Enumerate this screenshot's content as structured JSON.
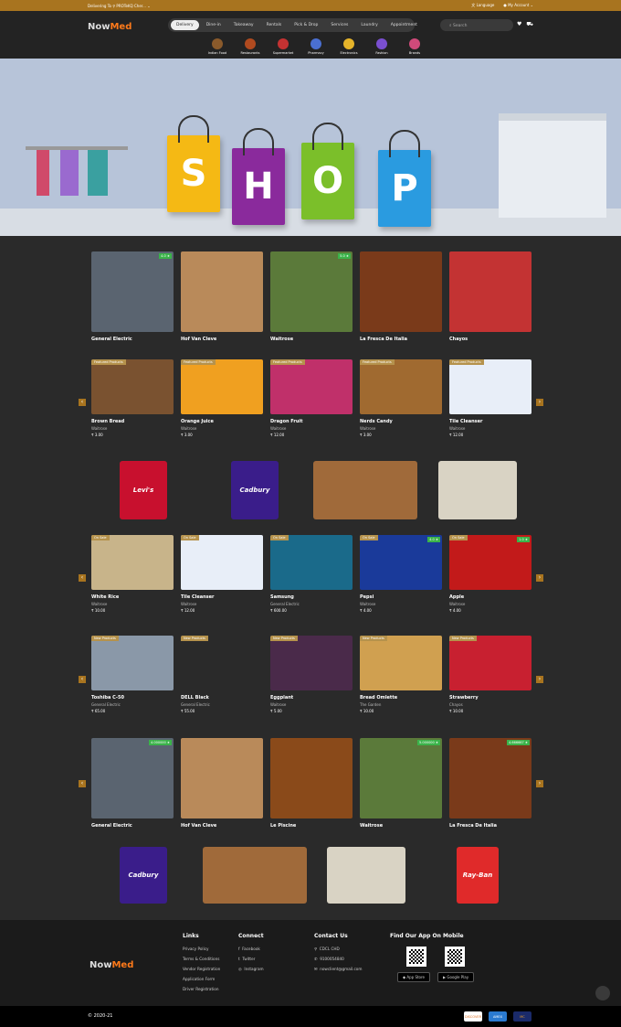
{
  "topbar": {
    "delivering": "Delivering To",
    "location": "PROTeKQ Cher...",
    "language": "Language",
    "account": "My Account"
  },
  "header": {
    "logo_a": "Now",
    "logo_b": "Med",
    "search_placeholder": "Search"
  },
  "nav": [
    "Delivery",
    "Dine-in",
    "Takeaway",
    "Rentals",
    "Pick & Drop",
    "Services",
    "Laundry",
    "Appointment"
  ],
  "categories": [
    {
      "label": "Indian Food",
      "color": "#8a5a2b"
    },
    {
      "label": "Restaurants",
      "color": "#b04a1f"
    },
    {
      "label": "Supermarket",
      "color": "#c43232"
    },
    {
      "label": "Pharmacy",
      "color": "#4a6fd1"
    },
    {
      "label": "Electronics",
      "color": "#e6b42a"
    },
    {
      "label": "Fashion",
      "color": "#7a4fd0"
    },
    {
      "label": "Brands",
      "color": "#d04a7a"
    }
  ],
  "banner": {
    "letters": [
      "S",
      "H",
      "O",
      "P"
    ],
    "colors": [
      "#f5b914",
      "#8a2a9c",
      "#7bbf2a",
      "#2a9be0"
    ]
  },
  "row1": [
    {
      "name": "General Electric",
      "rating": "4.0 ★",
      "color": "#5a6470"
    },
    {
      "name": "Hof Van Cleve",
      "rating": "",
      "color": "#b98a5a"
    },
    {
      "name": "Waitrose",
      "rating": "5.0 ★",
      "color": "#5b7a3a"
    },
    {
      "name": "La Fresca De Italia",
      "rating": "",
      "color": "#7a3a1a"
    },
    {
      "name": "Chayos",
      "rating": "",
      "color": "#c33333"
    }
  ],
  "row2": {
    "tag": "Featured Products",
    "items": [
      {
        "name": "Brown Bread",
        "store": "Waitrose",
        "price": "₹ 3.00",
        "color": "#7a5230"
      },
      {
        "name": "Orange Juice",
        "store": "Waitrose",
        "price": "₹ 3.00",
        "color": "#f0a020"
      },
      {
        "name": "Dragon Fruit",
        "store": "Waitrose",
        "price": "₹ 12.00",
        "color": "#c0306a"
      },
      {
        "name": "Nerds Candy",
        "store": "Waitrose",
        "price": "₹ 3.00",
        "color": "#a06a30"
      },
      {
        "name": "Tile Cleanser",
        "store": "Waitrose",
        "price": "₹ 12.00",
        "color": "#e8eef8"
      }
    ]
  },
  "brands1": [
    "Levi's",
    "Cadbury",
    "",
    ""
  ],
  "row3": {
    "tag": "On Sale",
    "items": [
      {
        "name": "White Rice",
        "store": "Waitrose",
        "price": "₹ 10.00",
        "color": "#c8b48a",
        "rating": ""
      },
      {
        "name": "Tile Cleanser",
        "store": "Waitrose",
        "price": "₹ 12.00",
        "color": "#e8eef8",
        "rating": ""
      },
      {
        "name": "Samsung",
        "store": "General Electric",
        "price": "₹ 600.00",
        "color": "#1a6a8a",
        "rating": ""
      },
      {
        "name": "Pepsi",
        "store": "Waitrose",
        "price": "₹ 4.00",
        "color": "#1a3a9a",
        "rating": "4.0 ★"
      },
      {
        "name": "Apple",
        "store": "Waitrose",
        "price": "₹ 4.00",
        "color": "#c21a1a",
        "rating": "1.0 ★"
      }
    ]
  },
  "row4": {
    "tag": "New Products",
    "items": [
      {
        "name": "Toshiba C-50",
        "store": "General Electric",
        "price": "₹ 65.00",
        "color": "#8a98a8"
      },
      {
        "name": "DELL Black",
        "store": "General Electric",
        "price": "₹ 55.00",
        "color": "#2a2a2a"
      },
      {
        "name": "Eggplant",
        "store": "Waitrose",
        "price": "₹ 5.00",
        "color": "#4a2a4a"
      },
      {
        "name": "Bread Omlette",
        "store": "The Garden",
        "price": "₹ 10.00",
        "color": "#d0a050"
      },
      {
        "name": "Strawberry",
        "store": "Chayos",
        "price": "₹ 10.00",
        "color": "#c82030"
      }
    ]
  },
  "row5": [
    {
      "name": "General Electric",
      "rating": "4.000000 ★",
      "color": "#5a6470"
    },
    {
      "name": "Hof Van Cleve",
      "rating": "",
      "color": "#b98a5a"
    },
    {
      "name": "Le Piscine",
      "rating": "",
      "color": "#8a4a1a"
    },
    {
      "name": "Waitrose",
      "rating": "5.000000 ★",
      "color": "#5b7a3a"
    },
    {
      "name": "La Fresca De Italia",
      "rating": "4.666667 ★",
      "color": "#7a3a1a"
    }
  ],
  "brands2": [
    "Cadbury",
    "",
    "",
    "Ray-Ban"
  ],
  "footer": {
    "links_title": "Links",
    "links": [
      "Privacy Policy",
      "Terms & Conditions",
      "Vendor Registration",
      "Application Form",
      "Driver Registration"
    ],
    "connect_title": "Connect",
    "connect": [
      "Facebook",
      "Twitter",
      "Instagram"
    ],
    "contact_title": "Contact Us",
    "contact": [
      "CDCL CHD",
      "9100054840",
      "nowclient@gmail.com"
    ],
    "app_title": "Find Our App On Mobile",
    "appstore": "App Store",
    "googleplay": "Google Play"
  },
  "bottom": {
    "copyright": "© 2020-21",
    "pay": [
      "DISCOVER",
      "AMEX",
      "MC"
    ]
  }
}
